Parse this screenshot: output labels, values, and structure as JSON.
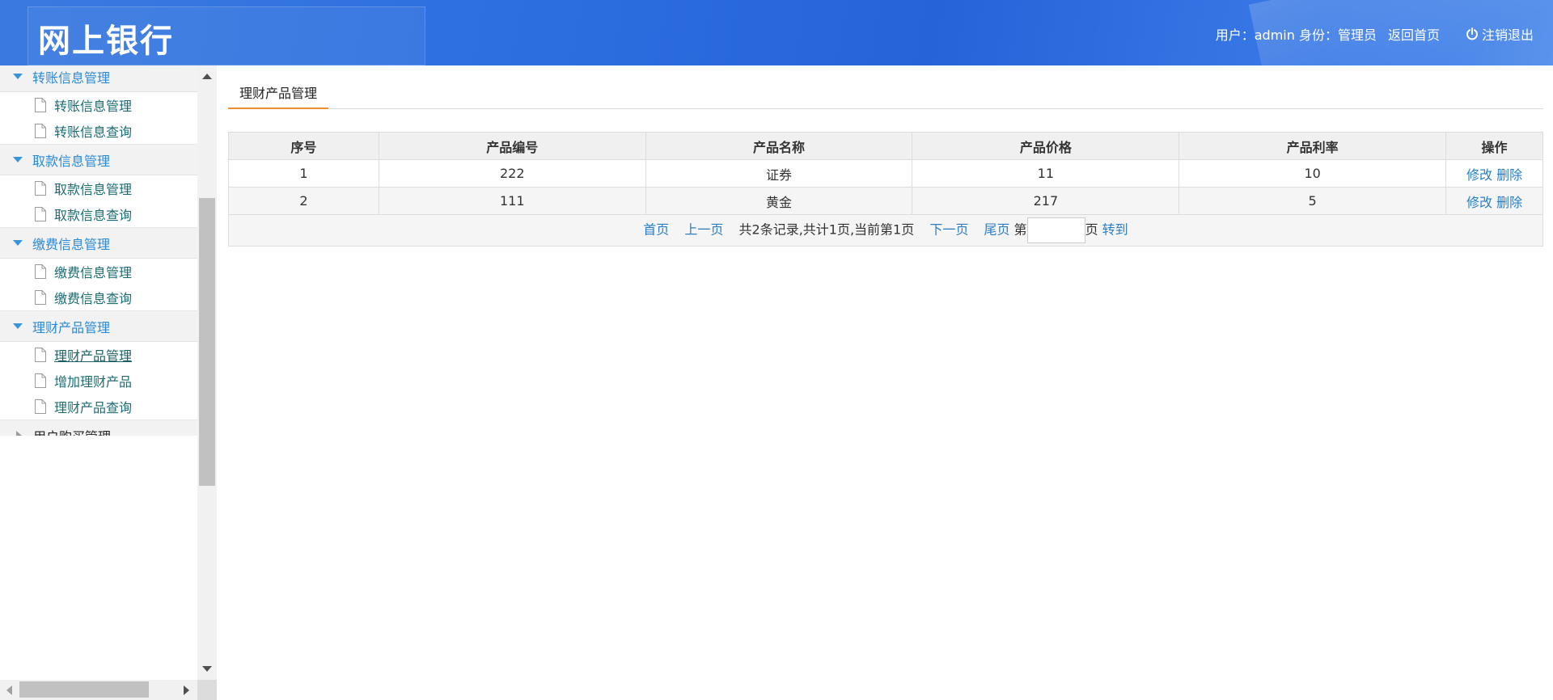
{
  "header": {
    "logo": "网上银行",
    "user_info": "用户：admin 身份：管理员",
    "home_link": "返回首页",
    "logout_link": "注销退出"
  },
  "sidebar": {
    "groups": [
      {
        "title": "转账信息管理",
        "items": [
          "转账信息管理",
          "转账信息查询"
        ]
      },
      {
        "title": "取款信息管理",
        "items": [
          "取款信息管理",
          "取款信息查询"
        ]
      },
      {
        "title": "缴费信息管理",
        "items": [
          "缴费信息管理",
          "缴费信息查询"
        ]
      },
      {
        "title": "理财产品管理",
        "items": [
          "理财产品管理",
          "增加理财产品",
          "理财产品查询"
        ]
      },
      {
        "title": "用户购买管理",
        "items": []
      }
    ],
    "active_item": "理财产品管理"
  },
  "main": {
    "tab": "理财产品管理",
    "table": {
      "headers": [
        "序号",
        "产品编号",
        "产品名称",
        "产品价格",
        "产品利率",
        "操作"
      ],
      "rows": [
        {
          "no": "1",
          "code": "222",
          "name": "证券",
          "price": "11",
          "rate": "10"
        },
        {
          "no": "2",
          "code": "111",
          "name": "黄金",
          "price": "217",
          "rate": "5"
        }
      ],
      "actions": {
        "edit": "修改",
        "delete": "删除"
      }
    },
    "pager": {
      "first": "首页",
      "prev": "上一页",
      "summary": "共2条记录,共计1页,当前第1页",
      "next": "下一页",
      "last": "尾页",
      "page_prefix": "第",
      "page_input_value": "",
      "page_suffix": "页",
      "go": "转到"
    }
  },
  "colors": {
    "header_blue": "#2c6ee0",
    "menu_group_blue": "#2b8ad6",
    "menu_item_teal": "#1c6b73",
    "link_blue": "#2b7ec4",
    "tab_underline_orange": "#f28a2e"
  }
}
